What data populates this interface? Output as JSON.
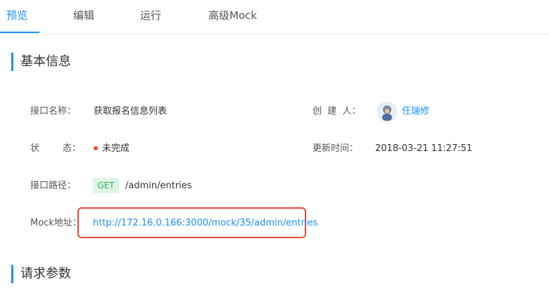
{
  "tabs": [
    {
      "label": "预览",
      "active": true
    },
    {
      "label": "编辑",
      "active": false
    },
    {
      "label": "运行",
      "active": false
    },
    {
      "label": "高级Mock",
      "active": false
    }
  ],
  "basic_info": {
    "title": "基本信息",
    "fields": {
      "api_name": {
        "label": "接口名称：",
        "value": "获取报名信息列表"
      },
      "creator": {
        "label": "创  建  人：",
        "value": "任瑞修"
      },
      "status": {
        "label": "状        态：",
        "value": "未完成"
      },
      "updated_time": {
        "label": "更新时间：",
        "value": "2018-03-21 11:27:51"
      },
      "api_path": {
        "label": "接口路径：",
        "method": "GET",
        "value": "/admin/entries"
      },
      "mock_address": {
        "label": "Mock地址：",
        "value": "http://172.16.0.166:3000/mock/35/admin/entries"
      }
    }
  },
  "request_params": {
    "title": "请求参数"
  },
  "colors": {
    "accent": "#1890ff",
    "status_incomplete": "#f5491e",
    "method_get_bg": "#dff5e6",
    "method_get_text": "#2fae61",
    "highlight_border": "#e64a32"
  }
}
